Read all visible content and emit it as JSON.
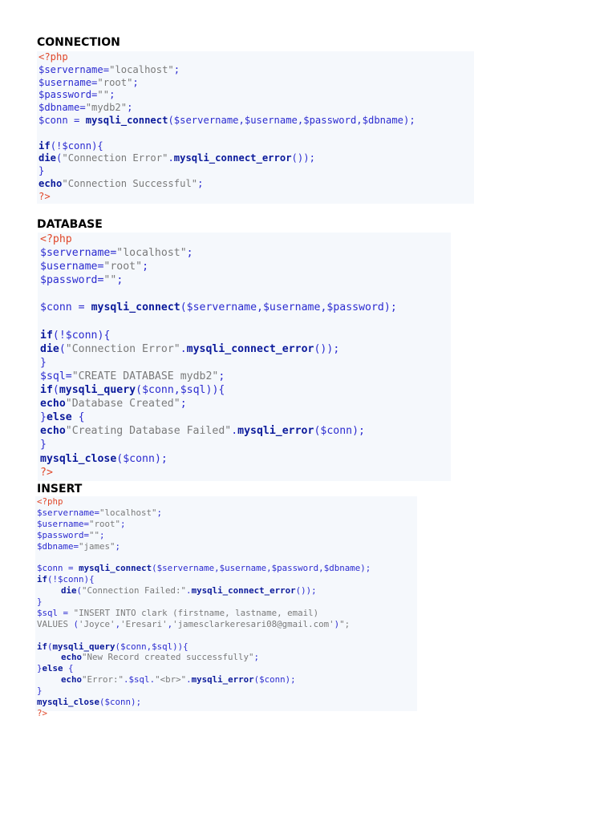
{
  "sections": [
    {
      "heading": "CONNECTION",
      "lines": [
        "<?php",
        "$servername=\"localhost\";",
        "$username=\"root\";",
        "$password=\"\";",
        "$dbname=\"mydb2\";",
        "$conn = mysqli_connect($servername,$username,$password,$dbname);",
        "",
        "if(!$conn){",
        "die(\"Connection Error\".mysqli_connect_error());",
        "}",
        "echo\"Connection Successful\";",
        "?>"
      ]
    },
    {
      "heading": "DATABASE",
      "lines": [
        "<?php",
        "$servername=\"localhost\";",
        "$username=\"root\";",
        "$password=\"\";",
        "",
        "$conn = mysqli_connect($servername,$username,$password);",
        "",
        "if(!$conn){",
        "die(\"Connection Error\".mysqli_connect_error());",
        "}",
        "$sql=\"CREATE DATABASE mydb2\";",
        "if(mysqli_query($conn,$sql)){",
        "echo\"Database Created\";",
        "}else {",
        "echo\"Creating Database Failed\".mysqli_error($conn);",
        "}",
        "mysqli_close($conn);",
        "?>"
      ]
    },
    {
      "heading": "INSERT",
      "lines": [
        "<?php",
        "$servername=\"localhost\";",
        "$username=\"root\";",
        "$password=\"\";",
        "$dbname=\"james\";",
        "",
        "$conn = mysqli_connect($servername,$username,$password,$dbname);",
        "if(!$conn){",
        "die(\"Connection Failed:\".mysqli_connect_error());",
        "}",
        "$sql = \"INSERT INTO clark (firstname, lastname, email)",
        "VALUES ('Joyce','Eresari','jamesclarkeresari08@gmail.com')\";",
        "",
        "if(mysqli_query($conn,$sql)){",
        "echo\"New Record created successfully\";",
        "}else {",
        "echo\"Error:\".$sql.\"<br>\".mysqli_error($conn);",
        "}",
        "mysqli_close($conn);",
        "?>"
      ]
    }
  ]
}
